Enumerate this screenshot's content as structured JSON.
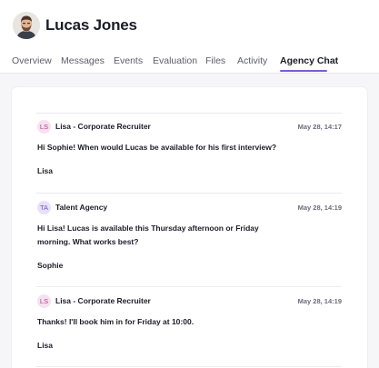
{
  "candidate": {
    "name": "Lucas Jones",
    "avatar_icon": "person-photo-avatar"
  },
  "tabs": [
    {
      "label": "Overview",
      "active": false
    },
    {
      "label": "Messages",
      "active": false
    },
    {
      "label": "Events",
      "active": false
    },
    {
      "label": "Evaluation",
      "active": false
    },
    {
      "label": "Files",
      "active": false
    },
    {
      "label": "Activity",
      "active": false
    },
    {
      "label": "Agency Chat",
      "active": true
    }
  ],
  "colors": {
    "accent": "#7a5bd9",
    "lisa_avatar_bg": "#f6e1ef",
    "lisa_avatar_fg": "#b53c8d",
    "agency_avatar_bg": "#e7e1f8",
    "agency_avatar_fg": "#6d52c6",
    "content_bg": "#f6f6f9"
  },
  "messages": [
    {
      "initials": "LS",
      "author": "Lisa - Corporate Recruiter",
      "time": "May 28, 14:17",
      "lines": [
        "Hi Sophie! When would Lucas be available for his first interview?"
      ],
      "signature": "Lisa"
    },
    {
      "initials": "TA",
      "author": "Talent Agency",
      "time": "May 28, 14:19",
      "lines": [
        "Hi Lisa! Lucas is available this Thursday afternoon or Friday",
        "morning. What works best?"
      ],
      "signature": "Sophie"
    },
    {
      "initials": "LS",
      "author": "Lisa - Corporate Recruiter",
      "time": "May 28, 14:19",
      "lines": [
        "Thanks! I'll book him in for Friday at 10:00."
      ],
      "signature": "Lisa"
    }
  ]
}
